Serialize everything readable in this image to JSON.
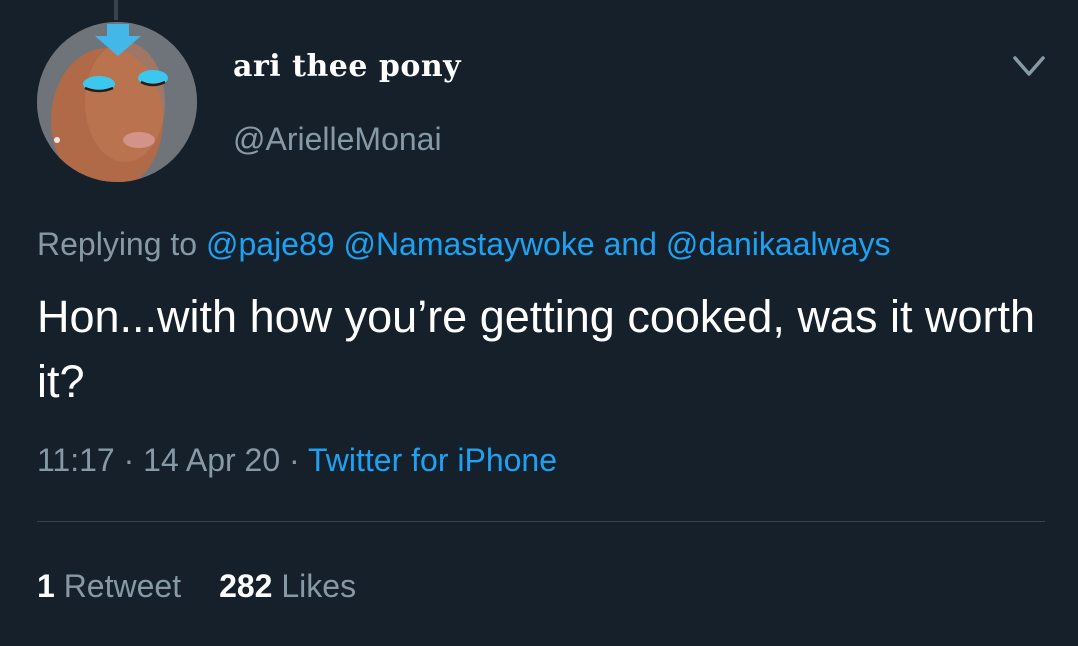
{
  "tweet": {
    "display_name": "ari thee pony",
    "handle": "@ArielleMonai",
    "replying_prefix": "Replying to",
    "reply_mentions": [
      "@paje89",
      "@Namastaywoke",
      "@danikaalways"
    ],
    "reply_conjunction": "and",
    "text": "Hon...with how you’re getting cooked, was it worth it?",
    "time": "11:17",
    "separator": "·",
    "date": "14 Apr 20",
    "source": "Twitter for iPhone",
    "retweets_count": "1",
    "retweets_label": "Retweet",
    "likes_count": "282",
    "likes_label": "Likes"
  },
  "icons": {
    "menu": "chevron-down-icon",
    "avatar": "avatar"
  },
  "colors": {
    "background": "#15202b",
    "primary_text": "#ffffff",
    "secondary_text": "#8899a6",
    "link": "#1da1f2",
    "divider": "#38444d"
  }
}
